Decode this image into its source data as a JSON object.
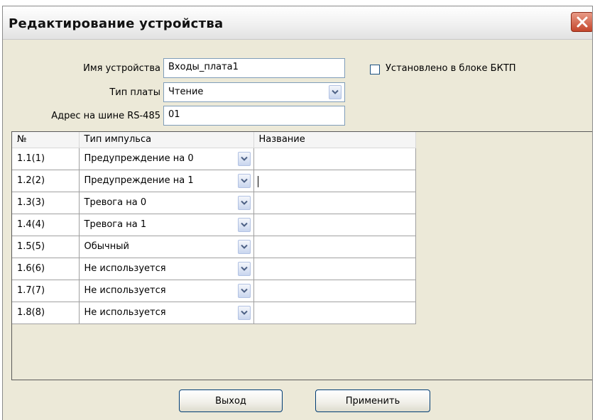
{
  "window": {
    "title": "Редактирование устройства"
  },
  "form": {
    "device_name_label": "Имя устройства",
    "device_name_value": "Входы_плата1",
    "board_type_label": "Тип платы",
    "board_type_value": "Чтение",
    "address_label": "Адрес на шине RS-485",
    "address_value": "01",
    "installed_label": "Установлено в блоке БКТП",
    "installed_checked": false
  },
  "table": {
    "columns": [
      "№",
      "Тип импульса",
      "Название"
    ],
    "rows": [
      {
        "num": "1.1(1)",
        "type": "Предупреждение на 0",
        "name": ""
      },
      {
        "num": "1.2(2)",
        "type": "Предупреждение на 1",
        "name": ""
      },
      {
        "num": "1.3(3)",
        "type": "Тревога на 0",
        "name": ""
      },
      {
        "num": "1.4(4)",
        "type": "Тревога на 1",
        "name": ""
      },
      {
        "num": "1.5(5)",
        "type": "Обычный",
        "name": ""
      },
      {
        "num": "1.6(6)",
        "type": "Не используется",
        "name": ""
      },
      {
        "num": "1.7(7)",
        "type": "Не используется",
        "name": ""
      },
      {
        "num": "1.8(8)",
        "type": "Не используется",
        "name": ""
      }
    ]
  },
  "buttons": {
    "exit_label": "Выход",
    "apply_label": "Применить"
  },
  "colors": {
    "window_bg": "#ece9d8",
    "close_button": "#c4462c",
    "field_border": "#7f9db9"
  },
  "icons": {
    "close": "close-icon",
    "dropdown": "chevron-down-icon"
  }
}
